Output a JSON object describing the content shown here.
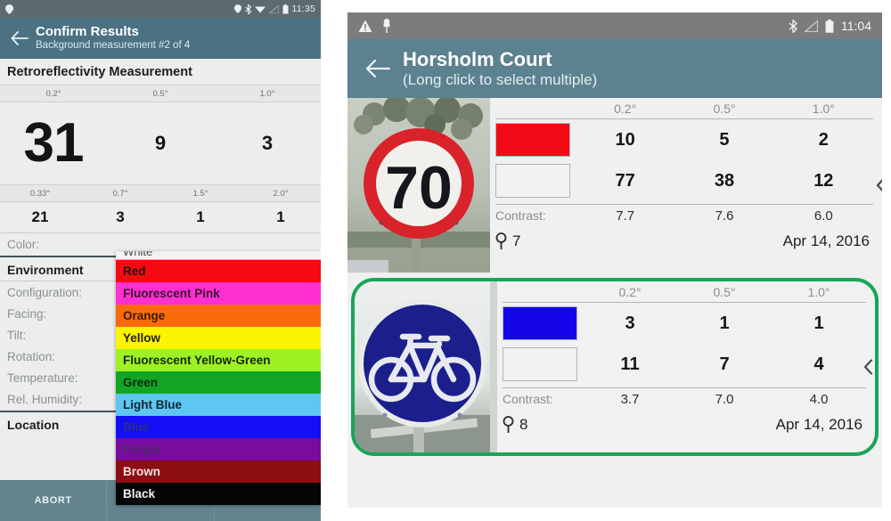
{
  "left_panel": {
    "status_bar": {
      "time": "11:35",
      "icons": [
        "location-pin-icon",
        "bluetooth-icon",
        "wifi-icon",
        "signal-icon",
        "battery-icon"
      ]
    },
    "app_bar": {
      "back_icon": "back-arrow-icon",
      "title": "Confirm Results",
      "subtitle": "Background measurement #2 of 4"
    },
    "section_title": "Retroreflectivity Measurement",
    "measurement_table": {
      "row1_angles": [
        "0.2°",
        "0.5°",
        "1.0°"
      ],
      "row1_values": [
        "31",
        "9",
        "3"
      ],
      "row2_angles": [
        "0.33°",
        "0.7°",
        "1.5°",
        "2.0°"
      ],
      "row2_values": [
        "21",
        "3",
        "1",
        "1"
      ]
    },
    "fields": [
      {
        "label": "Color:",
        "value": ""
      }
    ],
    "environment_heading": "Environment",
    "environment_fields": [
      {
        "label": "Configuration:",
        "value": ""
      },
      {
        "label": "Facing:",
        "value": ""
      },
      {
        "label": "Tilt:",
        "value": ""
      },
      {
        "label": "Rotation:",
        "value": ""
      },
      {
        "label": "Temperature:",
        "value": ""
      },
      {
        "label": "Rel. Humidity:",
        "value": ""
      }
    ],
    "location_heading": "Location",
    "color_dropdown": {
      "partial_top_item": "White",
      "items": [
        {
          "label": "Red",
          "bg": "#f40a10",
          "fg": "#1a1a1a"
        },
        {
          "label": "Fluorescent Pink",
          "bg": "#ff2fd0",
          "fg": "#3a1433"
        },
        {
          "label": "Orange",
          "bg": "#fa6a0a",
          "fg": "#3a1c00"
        },
        {
          "label": "Yellow",
          "bg": "#fbf400",
          "fg": "#26230a"
        },
        {
          "label": "Fluorescent Yellow-Green",
          "bg": "#9ef224",
          "fg": "#16290a"
        },
        {
          "label": "Green",
          "bg": "#12a524",
          "fg": "#0b2a10"
        },
        {
          "label": "Light Blue",
          "bg": "#5ec6f0",
          "fg": "#0f2733"
        },
        {
          "label": "Blue",
          "bg": "#130ef4",
          "fg": "#2a2f88"
        },
        {
          "label": "Purple",
          "bg": "#7a0ba0",
          "fg": "#4a2a63"
        },
        {
          "label": "Brown",
          "bg": "#8c0d12",
          "fg": "#f3e0e0"
        },
        {
          "label": "Black",
          "bg": "#050505",
          "fg": "#f2f2f2"
        }
      ]
    },
    "bottom_bar": {
      "abort_label": "ABORT",
      "cells": [
        "ABORT",
        "",
        ""
      ]
    }
  },
  "right_panel": {
    "status_bar": {
      "time": "11:04",
      "icons": [
        "warning-triangle-icon",
        "usb-icon",
        "bluetooth-icon",
        "signal-icon",
        "battery-icon"
      ]
    },
    "app_bar": {
      "back_icon": "back-arrow-icon",
      "title": "Horsholm Court",
      "subtitle": "(Long click to select multiple)"
    },
    "angle_headers": [
      "0.2°",
      "0.5°",
      "1.0°"
    ],
    "contrast_label": "Contrast:",
    "chevron_icon": "chevron-left-icon",
    "pin_icon": "location-pin-icon",
    "cards": [
      {
        "photo": "speed-limit-70-sign",
        "photo_alt": "70",
        "selected": false,
        "swatch_color": "#f20b16",
        "swatch_bg_color": "#f2f2f2",
        "values_top": [
          "10",
          "5",
          "2"
        ],
        "values_bottom": [
          "77",
          "38",
          "12"
        ],
        "contrast": [
          "7.7",
          "7.6",
          "6.0"
        ],
        "id": "7",
        "date": "Apr 14, 2016"
      },
      {
        "photo": "bicycle-route-sign",
        "photo_alt": "bicycle",
        "selected": true,
        "swatch_color": "#1505e8",
        "swatch_bg_color": "#f2f2f2",
        "values_top": [
          "3",
          "1",
          "1"
        ],
        "values_bottom": [
          "11",
          "7",
          "4"
        ],
        "contrast": [
          "3.7",
          "7.0",
          "4.0"
        ],
        "id": "8",
        "date": "Apr 14, 2016"
      }
    ]
  },
  "colors": {
    "left_appbar": "#4b7183",
    "right_appbar": "#5c818f",
    "left_statusbar": "#5d6b70",
    "right_statusbar": "#7c7c7c",
    "selection_green": "#19a558",
    "bottom_bar": "#63848f"
  }
}
